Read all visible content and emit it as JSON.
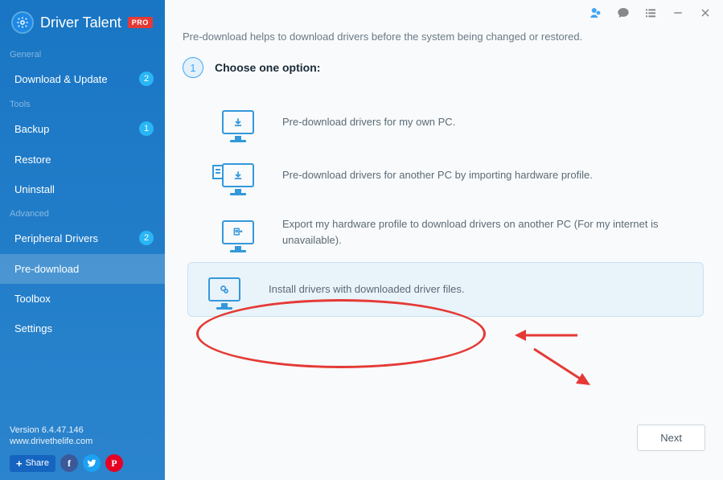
{
  "app": {
    "name": "Driver Talent",
    "badge": "PRO"
  },
  "sidebar": {
    "sections": {
      "general": "General",
      "tools": "Tools",
      "advanced": "Advanced"
    },
    "items": {
      "download_update": {
        "label": "Download & Update",
        "count": "2"
      },
      "backup": {
        "label": "Backup",
        "count": "1"
      },
      "restore": {
        "label": "Restore"
      },
      "uninstall": {
        "label": "Uninstall"
      },
      "peripheral": {
        "label": "Peripheral Drivers",
        "count": "2"
      },
      "predownload": {
        "label": "Pre-download"
      },
      "toolbox": {
        "label": "Toolbox"
      },
      "settings": {
        "label": "Settings"
      }
    },
    "footer": {
      "version": "Version 6.4.47.146",
      "website": "www.drivethelife.com",
      "share": "Share"
    }
  },
  "main": {
    "description": "Pre-download helps to download drivers before the system being changed or restored.",
    "step_number": "1",
    "step_title": "Choose one option:",
    "options": {
      "opt1": "Pre-download drivers for my own PC.",
      "opt2": "Pre-download drivers for another PC by importing hardware profile.",
      "opt3": "Export my hardware profile to download drivers on another PC (For my internet is unavailable).",
      "opt4": "Install drivers with downloaded driver files."
    },
    "next": "Next"
  }
}
